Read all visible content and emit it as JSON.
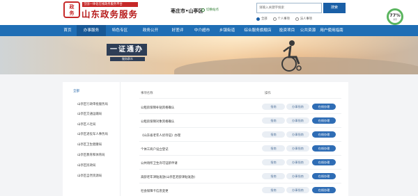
{
  "header": {
    "logo_sub": "全国一体化在线政务服务平台",
    "logo_title": "山东政务服务",
    "region": "枣庄市•山亭区",
    "switch_label": "切换站点",
    "search_placeholder": "请输入关键字搜索",
    "search_button": "搜索",
    "scope_options": [
      "全部",
      "个人事项",
      "法人事项"
    ],
    "gauge_value": "77%",
    "gauge_unit": "满意"
  },
  "nav": [
    "首页",
    "办事服务",
    "特色专区",
    "政务公开",
    "好差评",
    "中介超市",
    "乡镇街道",
    "综合服务旗舰店",
    "投资项目",
    "公共资源",
    "用户使用指南"
  ],
  "banner": {
    "title": "一证通办",
    "subtitle": "服务群众"
  },
  "sidebar": {
    "head": "全部",
    "items": [
      "山亭区行政审批服务局",
      "山亭区交通运输局",
      "山亭区人社局",
      "山亭区退役军人事务局",
      "山亭区卫生健康局",
      "山亭区教育和体育局",
      "山亭区民政局",
      "山亭区自然资源局"
    ]
  },
  "table": {
    "col_name": "事项名称",
    "col_action": "操作",
    "guide_label": "指南",
    "offline_label": "办事指南",
    "online_label": "在线办理",
    "rows": [
      "公租房保障补贴资格确认",
      "公租房保障对象资格确认",
      "《山东省老年人优待证》办理",
      "个体工商户设立登记",
      "公共场所卫生许可证新申请",
      "高龄老年津贴发放(山亭区老龄津贴发放)",
      "社会保障卡信息变更"
    ]
  },
  "colors": {
    "nav_blue": "#1f6eb5",
    "brand_red": "#b71c1c",
    "online_button": "#2f6db5"
  }
}
